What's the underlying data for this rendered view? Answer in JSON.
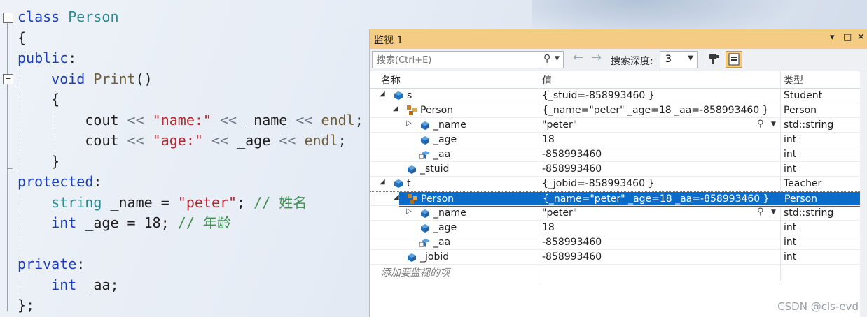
{
  "editor": {
    "lines": [
      {
        "segments": [
          [
            "kw",
            "class"
          ],
          [
            "",
            ""
          ],
          [
            "ty",
            " Person"
          ]
        ]
      },
      {
        "segments": [
          [
            "",
            "{"
          ]
        ]
      },
      {
        "segments": [
          [
            "kw",
            "public"
          ],
          [
            "",
            ":"
          ]
        ]
      },
      {
        "segments": [
          [
            "",
            "    "
          ],
          [
            "kw",
            "void"
          ],
          [
            "",
            ""
          ],
          [
            "fn",
            " Print"
          ],
          [
            "",
            "()"
          ]
        ]
      },
      {
        "segments": [
          [
            "",
            "    {"
          ]
        ]
      },
      {
        "segments": [
          [
            "",
            "        cout "
          ],
          [
            "op",
            "<<"
          ],
          [
            "",
            ""
          ],
          [
            "st",
            " \"name:\""
          ],
          [
            "",
            ""
          ],
          [
            "op",
            " <<"
          ],
          [
            "",
            " _name "
          ],
          [
            "op",
            "<<"
          ],
          [
            "fn",
            " endl"
          ],
          [
            "",
            ";"
          ]
        ]
      },
      {
        "segments": [
          [
            "",
            "        cout "
          ],
          [
            "op",
            "<<"
          ],
          [
            "",
            ""
          ],
          [
            "st",
            " \"age:\""
          ],
          [
            "",
            ""
          ],
          [
            "op",
            " <<"
          ],
          [
            "",
            " _age "
          ],
          [
            "op",
            "<<"
          ],
          [
            "fn",
            " endl"
          ],
          [
            "",
            ";"
          ]
        ]
      },
      {
        "segments": [
          [
            "",
            "    }"
          ]
        ]
      },
      {
        "segments": [
          [
            "kw",
            "protected"
          ],
          [
            "",
            ":"
          ]
        ]
      },
      {
        "segments": [
          [
            "",
            "    "
          ],
          [
            "ty",
            "string"
          ],
          [
            "",
            " _name = "
          ],
          [
            "st",
            "\"peter\""
          ],
          [
            "",
            "; "
          ],
          [
            "cm",
            "// 姓名"
          ]
        ]
      },
      {
        "segments": [
          [
            "",
            "    "
          ],
          [
            "kw",
            "int"
          ],
          [
            "",
            " _age = 18; "
          ],
          [
            "cm",
            "// 年龄"
          ]
        ]
      },
      {
        "segments": [
          [
            "",
            ""
          ]
        ]
      },
      {
        "segments": [
          [
            "kw",
            "private"
          ],
          [
            "",
            ":"
          ]
        ]
      },
      {
        "segments": [
          [
            "",
            "    "
          ],
          [
            "kw",
            "int"
          ],
          [
            "",
            " _aa;"
          ]
        ]
      },
      {
        "segments": [
          [
            "",
            "};"
          ]
        ]
      }
    ]
  },
  "watch": {
    "title": "监视 1",
    "title_buttons": [
      "▾",
      "□",
      "✕"
    ],
    "search_placeholder": "搜索(Ctrl+E)",
    "depth_label": "搜索深度:",
    "depth_value": "3",
    "columns": [
      "名称",
      "值",
      "类型"
    ],
    "rows": [
      {
        "indent": 0,
        "expander": "◢",
        "icon": "object",
        "name": "s",
        "value": "{_stuid=-858993460 }",
        "type": "Student",
        "selected": false,
        "magnifier": false
      },
      {
        "indent": 1,
        "expander": "◢",
        "icon": "base-class",
        "name": "Person",
        "value": "{_name=\"peter\" _age=18 _aa=-858993460 }",
        "type": "Person",
        "selected": false,
        "magnifier": false
      },
      {
        "indent": 2,
        "expander": "▷",
        "icon": "field",
        "name": "_name",
        "value": "\"peter\"",
        "type": "std::string",
        "selected": false,
        "magnifier": true
      },
      {
        "indent": 2,
        "expander": "",
        "icon": "field",
        "name": "_age",
        "value": "18",
        "type": "int",
        "selected": false,
        "magnifier": false
      },
      {
        "indent": 2,
        "expander": "",
        "icon": "private-field",
        "name": "_aa",
        "value": "-858993460",
        "type": "int",
        "selected": false,
        "magnifier": false
      },
      {
        "indent": 1,
        "expander": "",
        "icon": "field",
        "name": "_stuid",
        "value": "-858993460",
        "type": "int",
        "selected": false,
        "magnifier": false
      },
      {
        "indent": 0,
        "expander": "◢",
        "icon": "object",
        "name": "t",
        "value": "{_jobid=-858993460 }",
        "type": "Teacher",
        "selected": false,
        "magnifier": false
      },
      {
        "indent": 1,
        "expander": "◢",
        "icon": "base-class",
        "name": "Person",
        "value": "{_name=\"peter\" _age=18 _aa=-858993460 }",
        "type": "Person",
        "selected": true,
        "magnifier": false
      },
      {
        "indent": 2,
        "expander": "▷",
        "icon": "field",
        "name": "_name",
        "value": "\"peter\"",
        "type": "std::string",
        "selected": false,
        "magnifier": true
      },
      {
        "indent": 2,
        "expander": "",
        "icon": "field",
        "name": "_age",
        "value": "18",
        "type": "int",
        "selected": false,
        "magnifier": false
      },
      {
        "indent": 2,
        "expander": "",
        "icon": "private-field",
        "name": "_aa",
        "value": "-858993460",
        "type": "int",
        "selected": false,
        "magnifier": false
      },
      {
        "indent": 1,
        "expander": "",
        "icon": "field",
        "name": "_jobid",
        "value": "-858993460",
        "type": "int",
        "selected": false,
        "magnifier": false
      }
    ],
    "add_watch_placeholder": "添加要监视的项"
  },
  "watermark": "CSDN @cls-evd",
  "colors": {
    "title_bar": "#f5cc84",
    "selection": "#0a6bc9",
    "keyword": "#1a3cbf",
    "type": "#2b8a8f",
    "string": "#b5282e",
    "comment": "#3f8f4e"
  }
}
